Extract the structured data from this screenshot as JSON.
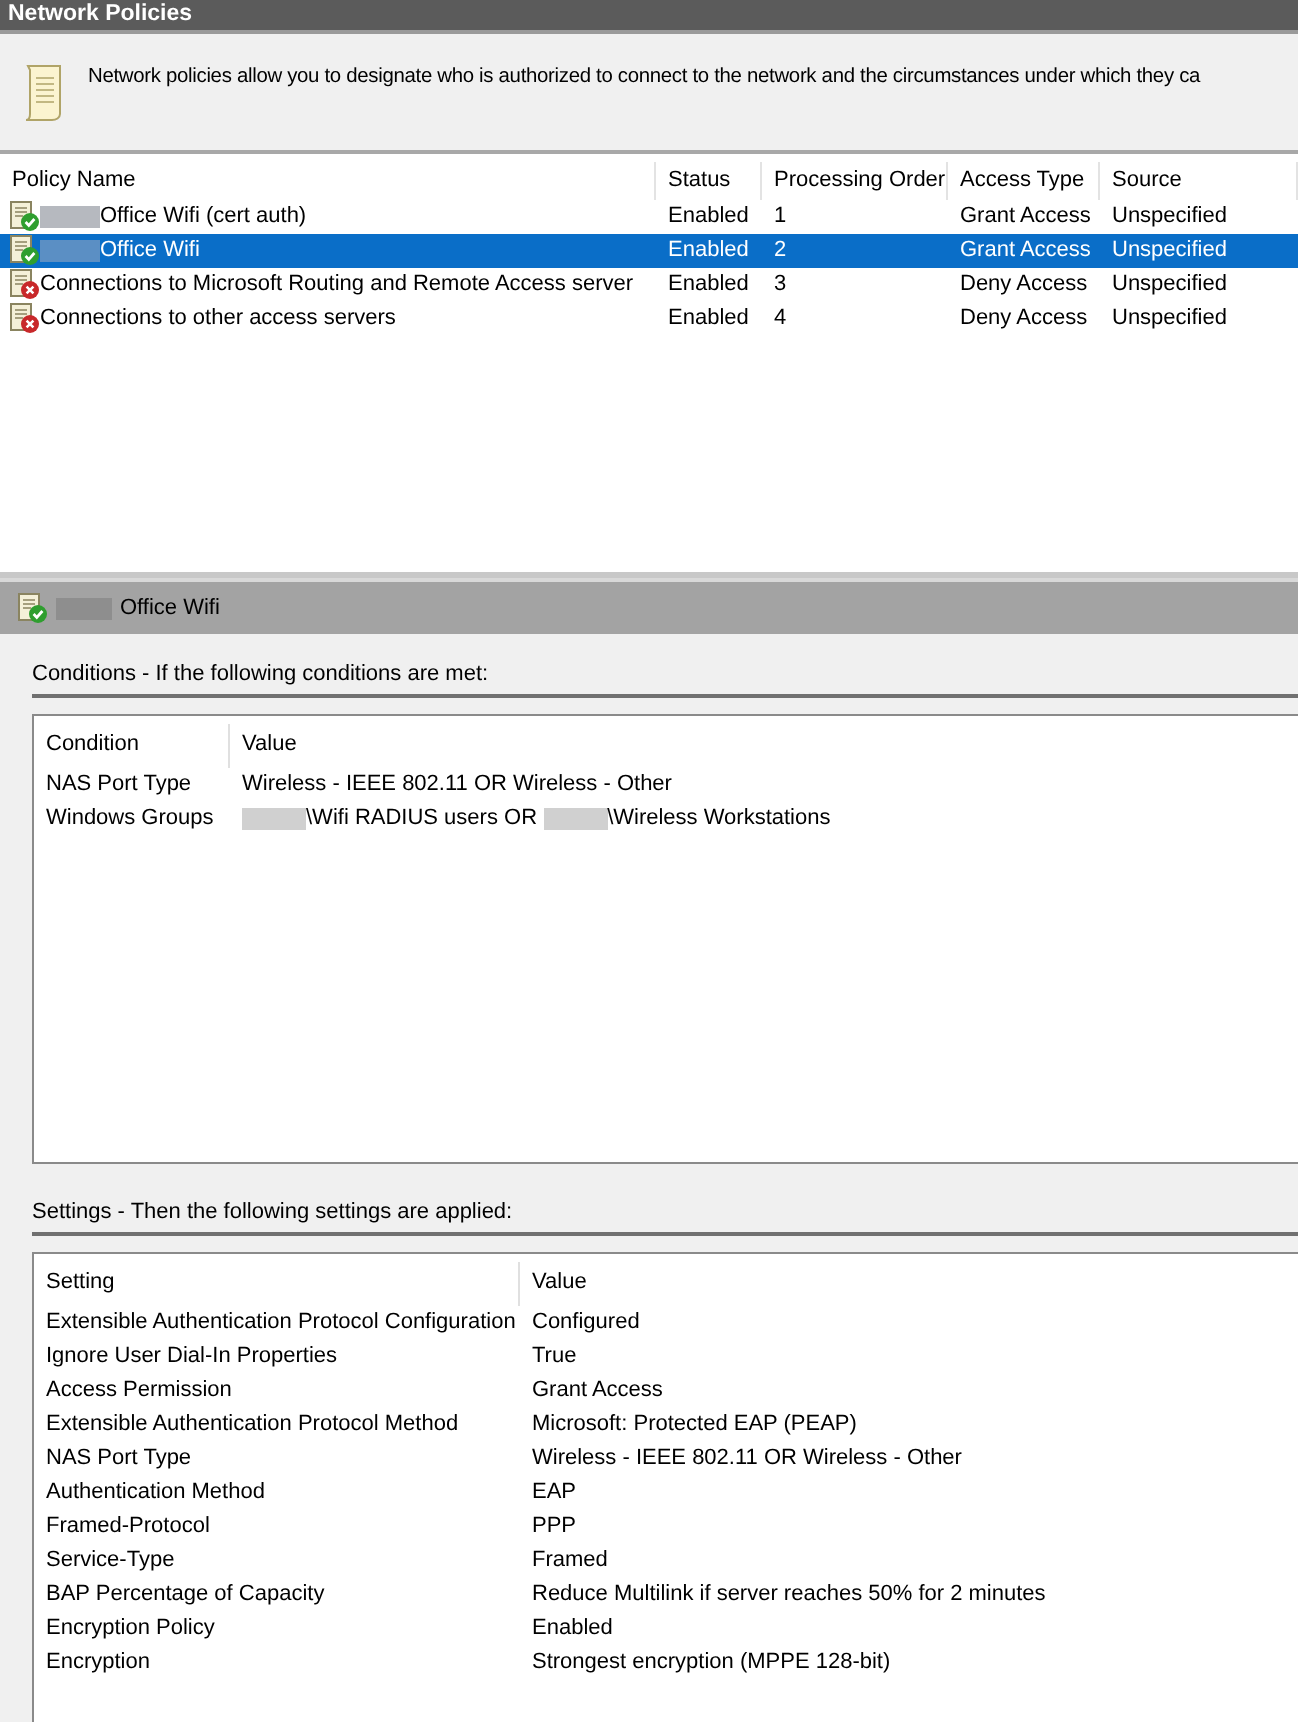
{
  "window": {
    "title": "Network Policies"
  },
  "description": "Network policies allow you to designate who is authorized to connect to the network and the circumstances under which they ca",
  "policies": {
    "columns": [
      "Policy Name",
      "Status",
      "Processing Order",
      "Access Type",
      "Source"
    ],
    "rows": [
      {
        "redacted": true,
        "name": "Office Wifi (cert auth)",
        "kind": "grant",
        "status": "Enabled",
        "order": "1",
        "access_type": "Grant Access",
        "source": "Unspecified",
        "selected": false
      },
      {
        "redacted": true,
        "name": "Office Wifi",
        "kind": "grant",
        "status": "Enabled",
        "order": "2",
        "access_type": "Grant Access",
        "source": "Unspecified",
        "selected": true
      },
      {
        "redacted": false,
        "name": "Connections to Microsoft Routing and Remote Access server",
        "kind": "deny",
        "status": "Enabled",
        "order": "3",
        "access_type": "Deny Access",
        "source": "Unspecified",
        "selected": false
      },
      {
        "redacted": false,
        "name": "Connections to other access servers",
        "kind": "deny",
        "status": "Enabled",
        "order": "4",
        "access_type": "Deny Access",
        "source": "Unspecified",
        "selected": false
      }
    ]
  },
  "details": {
    "redacted": true,
    "title": "Office Wifi",
    "kind": "grant",
    "conditions": {
      "label": "Conditions - If the following conditions are met:",
      "columns": [
        "Condition",
        "Value"
      ],
      "rows": [
        {
          "name": "NAS Port Type",
          "value": [
            {
              "kind": "text",
              "text": "Wireless - IEEE 802.11 OR Wireless - Other"
            }
          ]
        },
        {
          "name": "Windows Groups",
          "value": [
            {
              "kind": "redacted"
            },
            {
              "kind": "text",
              "text": "\\Wifi RADIUS users OR "
            },
            {
              "kind": "redacted"
            },
            {
              "kind": "text",
              "text": "\\Wireless Workstations"
            }
          ]
        }
      ]
    },
    "settings": {
      "label": "Settings - Then the following settings are applied:",
      "columns": [
        "Setting",
        "Value"
      ],
      "rows": [
        {
          "name": "Extensible Authentication Protocol Configuration",
          "value": "Configured"
        },
        {
          "name": "Ignore User Dial-In Properties",
          "value": "True"
        },
        {
          "name": "Access Permission",
          "value": "Grant Access"
        },
        {
          "name": "Extensible Authentication Protocol Method",
          "value": "Microsoft: Protected EAP (PEAP)"
        },
        {
          "name": "NAS Port Type",
          "value": "Wireless - IEEE 802.11 OR Wireless - Other"
        },
        {
          "name": "Authentication Method",
          "value": "EAP"
        },
        {
          "name": "Framed-Protocol",
          "value": "PPP"
        },
        {
          "name": "Service-Type",
          "value": "Framed"
        },
        {
          "name": "BAP Percentage of Capacity",
          "value": "Reduce Multilink if server reaches 50% for 2 minutes"
        },
        {
          "name": "Encryption Policy",
          "value": "Enabled"
        },
        {
          "name": "Encryption",
          "value": "Strongest encryption (MPPE 128-bit)"
        }
      ]
    }
  }
}
